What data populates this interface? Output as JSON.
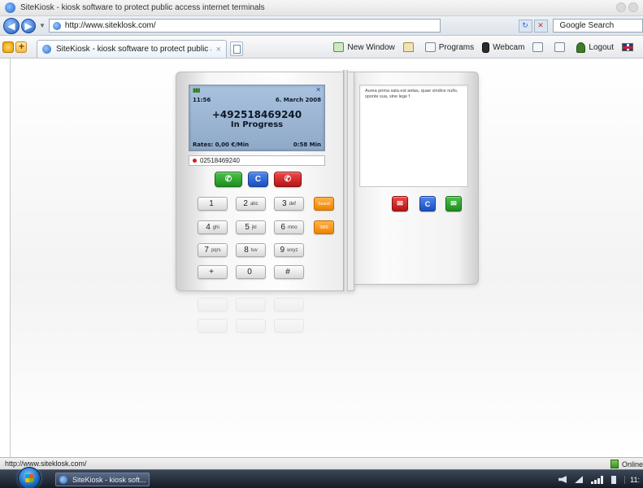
{
  "window": {
    "title": "SiteKiosk - kiosk software to protect public access internet terminals"
  },
  "addressbar": {
    "url": "http://www.siteklosk.com/",
    "search_placeholder": "Google Search"
  },
  "toolbar": {
    "tab_title": "SiteKiosk - kiosk software to protect public access",
    "tab_close": "×",
    "new_window": "New Window",
    "programs": "Programs",
    "webcam": "Webcam",
    "logout": "Logout"
  },
  "phone": {
    "time": "11:56",
    "date": "6. March 2008",
    "number": "+492518469240",
    "status": "In Progress",
    "rates": "Rates: 0,00 €/Min",
    "duration": "0:58 Min",
    "dial_value": "02518469240",
    "call_button_icon": "phone-call-icon",
    "clear_button_label": "C",
    "hangup_button_icon": "phone-hangup-icon",
    "keys": [
      {
        "digit": "1",
        "letters": ""
      },
      {
        "digit": "2",
        "letters": "abc"
      },
      {
        "digit": "3",
        "letters": "def"
      },
      {
        "digit": "4",
        "letters": "ghi"
      },
      {
        "digit": "5",
        "letters": "jkl"
      },
      {
        "digit": "6",
        "letters": "mno"
      },
      {
        "digit": "7",
        "letters": "pqrs"
      },
      {
        "digit": "8",
        "letters": "tuv"
      },
      {
        "digit": "9",
        "letters": "wxyz"
      },
      {
        "digit": "+",
        "letters": ""
      },
      {
        "digit": "0",
        "letters": ""
      },
      {
        "digit": "#",
        "letters": ""
      }
    ],
    "side_keys": [
      "Sound",
      "SMS"
    ]
  },
  "message": {
    "text": "Aurea prima sata est aetas, quae vindice nullo, sponte sua, sine lege f",
    "delete_button_icon": "delete-message-icon",
    "clear_button_label": "C",
    "send_button_icon": "send-message-icon"
  },
  "statusbar": {
    "url": "http://www.siteklosk.com/",
    "online": "Online"
  },
  "taskbar": {
    "task_label": "SiteKiosk - kiosk soft...",
    "clock": "11:"
  },
  "colors": {
    "accent_blue": "#1b4fbf",
    "call_green": "#1f8d1f",
    "hangup_red": "#b51616",
    "lcd_blue": "#9cb6d4"
  }
}
